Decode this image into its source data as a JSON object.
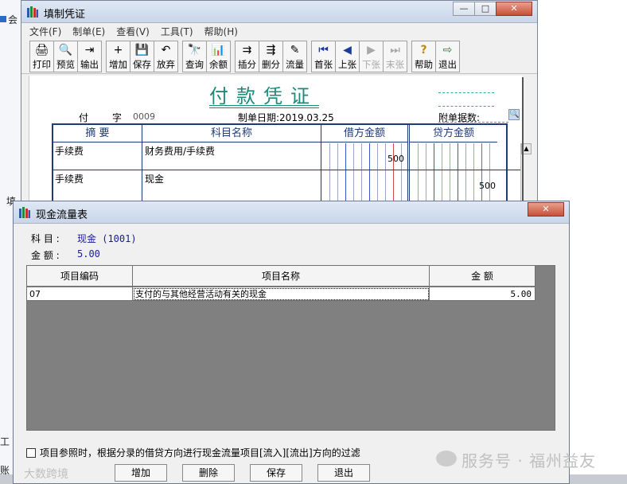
{
  "background": {
    "left_fragments": [
      "会",
      "填",
      "工",
      "账"
    ]
  },
  "main_window": {
    "title": "填制凭证",
    "controls": {
      "minimize": "—",
      "maximize": "□",
      "close": "✕"
    },
    "menu": [
      "文件(F)",
      "制单(E)",
      "查看(V)",
      "工具(T)",
      "帮助(H)"
    ],
    "toolbar_groups": [
      [
        {
          "label": "打印",
          "icon": "🖨"
        },
        {
          "label": "预览",
          "icon": "🔍"
        },
        {
          "label": "输出",
          "icon": "⇥"
        }
      ],
      [
        {
          "label": "增加",
          "icon": "+"
        },
        {
          "label": "保存",
          "icon": "💾"
        },
        {
          "label": "放弃",
          "icon": "↶"
        }
      ],
      [
        {
          "label": "查询",
          "icon": "🔭"
        },
        {
          "label": "余额",
          "icon": "📊"
        }
      ],
      [
        {
          "label": "插分",
          "icon": "⇉"
        },
        {
          "label": "删分",
          "icon": "⇶"
        },
        {
          "label": "流量",
          "icon": "✎"
        }
      ],
      [
        {
          "label": "首张",
          "icon": "⏮",
          "disabled": false
        },
        {
          "label": "上张",
          "icon": "◀",
          "disabled": false
        },
        {
          "label": "下张",
          "icon": "▶",
          "disabled": true
        },
        {
          "label": "末张",
          "icon": "⏭",
          "disabled": true
        }
      ],
      [
        {
          "label": "帮助",
          "icon": "?"
        },
        {
          "label": "退出",
          "icon": "⇨"
        }
      ]
    ],
    "voucher": {
      "title": "付款凭证",
      "type_char1": "付",
      "type_char2": "字",
      "number": "0009",
      "date_label": "制单日期:2019.03.25",
      "attachments_label": "附单据数:",
      "columns": {
        "summary": "摘 要",
        "account": "科目名称",
        "debit": "借方金额",
        "credit": "贷方金额"
      },
      "rows": [
        {
          "summary": "手续费",
          "account": "财务费用/手续费",
          "debit": "500",
          "credit": ""
        },
        {
          "summary": "手续费",
          "account": "现金",
          "debit": "",
          "credit": "500"
        }
      ]
    }
  },
  "dialog": {
    "title": "现金流量表",
    "close": "✕",
    "subject_label": "科 目 :",
    "subject_value": "现金 (1001)",
    "amount_label": "金 额 :",
    "amount_value": "5.00",
    "columns": [
      "项目编码",
      "项目名称",
      "金 额"
    ],
    "rows": [
      {
        "code": "07",
        "name": "支付的与其他经营活动有关的现金",
        "amount": "5.00"
      }
    ],
    "filter_checkbox": "项目参照时，根据分录的借贷方向进行现金流量项目[流入][流出]方向的过滤",
    "buttons": [
      "增加",
      "删除",
      "保存",
      "退出"
    ]
  },
  "watermark": {
    "text": "服务号 · 福州益友",
    "text2": "大数跨境"
  },
  "colors": {
    "voucher_title": "#1a8a7a",
    "grid_border": "#1e3a78",
    "table_bg": "#808080"
  }
}
